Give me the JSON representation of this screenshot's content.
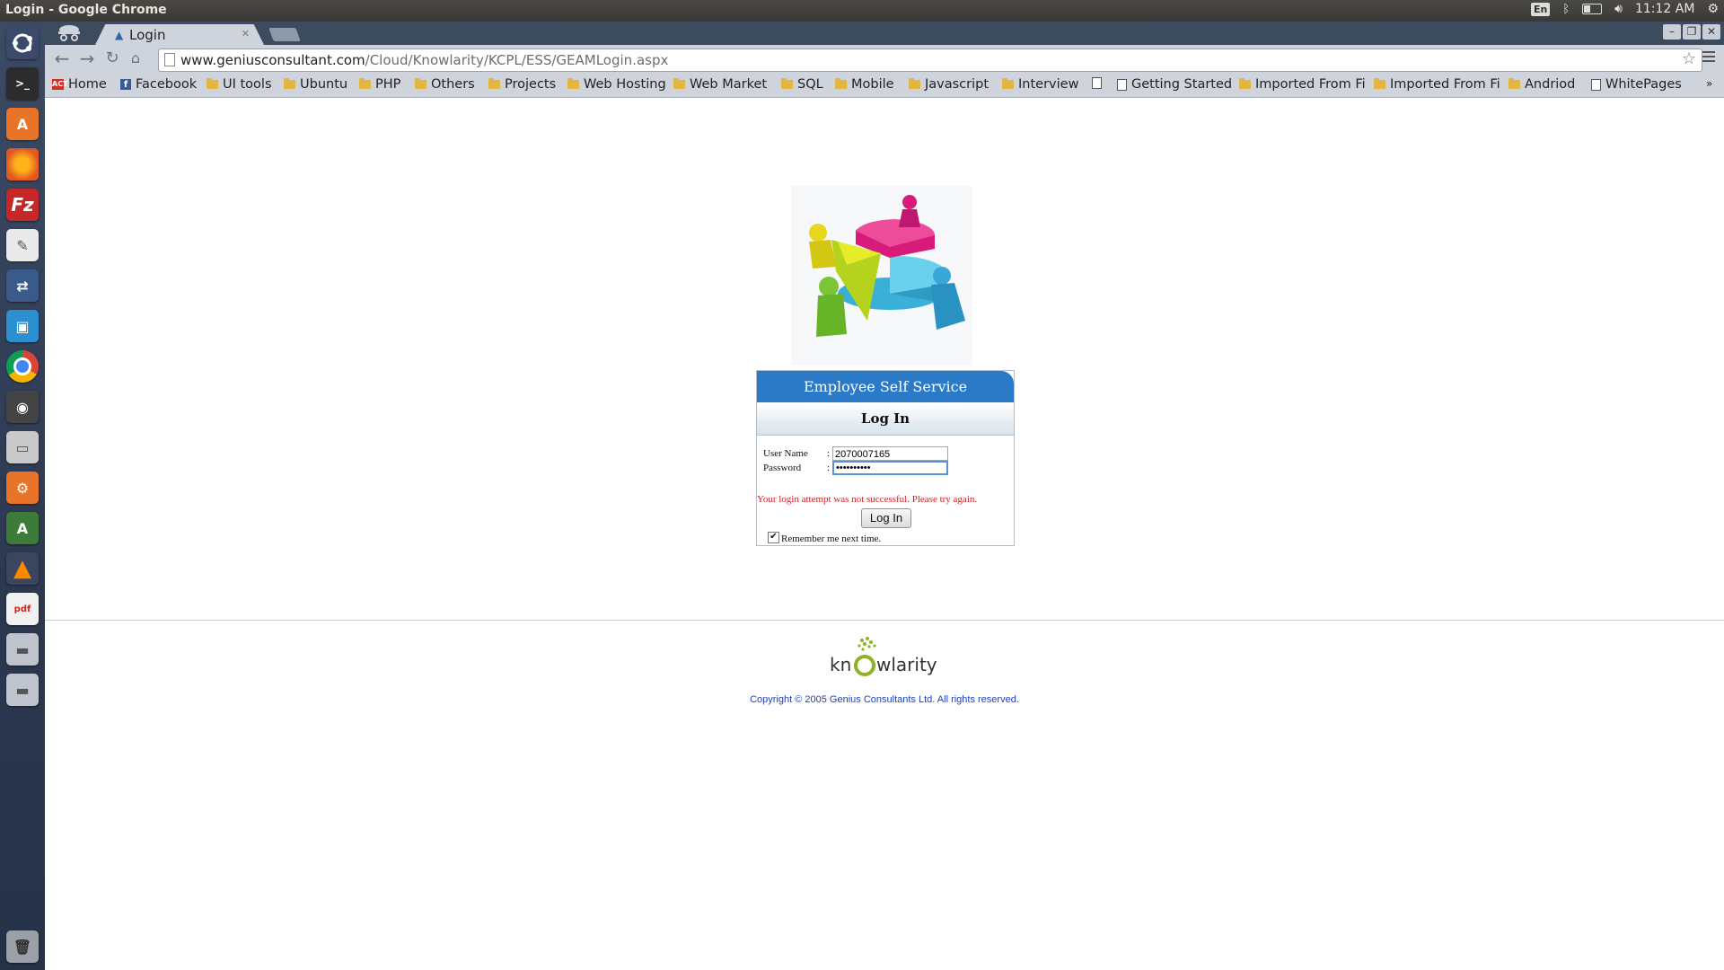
{
  "system_panel": {
    "window_title": "Login - Google Chrome",
    "keyboard_layout": "En",
    "clock": "11:12 AM"
  },
  "launcher": {
    "icons": [
      "ubuntu-dash-icon",
      "terminal-icon",
      "software-center-icon",
      "firefox-icon",
      "filezilla-icon",
      "text-editor-icon",
      "remote-desktop-icon",
      "app-icon",
      "chrome-icon",
      "camera-icon",
      "files-icon",
      "settings-icon",
      "android-studio-icon",
      "vlc-icon",
      "document-viewer-icon",
      "drive-icon",
      "drive-icon",
      "trash-icon"
    ]
  },
  "browser": {
    "tab_title": "Login",
    "url_host": "www.geniusconsultant.com",
    "url_path": "/Cloud/Knowlarity/KCPL/ESS/GEAMLogin.aspx",
    "bookmarks": [
      {
        "label": "Home",
        "icon": "home-favicon"
      },
      {
        "label": "Facebook",
        "icon": "facebook-favicon"
      },
      {
        "label": "UI tools",
        "icon": "folder-icon"
      },
      {
        "label": "Ubuntu",
        "icon": "folder-icon"
      },
      {
        "label": "PHP",
        "icon": "folder-icon"
      },
      {
        "label": "Others",
        "icon": "folder-icon"
      },
      {
        "label": "Projects",
        "icon": "folder-icon"
      },
      {
        "label": "Web Hosting",
        "icon": "folder-icon"
      },
      {
        "label": "Web Market",
        "icon": "folder-icon"
      },
      {
        "label": "SQL",
        "icon": "folder-icon"
      },
      {
        "label": "Mobile",
        "icon": "folder-icon"
      },
      {
        "label": "Javascript",
        "icon": "folder-icon"
      },
      {
        "label": "Interview",
        "icon": "folder-icon"
      },
      {
        "label": "",
        "icon": "page-icon"
      },
      {
        "label": "Getting Started",
        "icon": "page-icon"
      },
      {
        "label": "Imported From Fi",
        "icon": "folder-icon"
      },
      {
        "label": "Imported From Fi",
        "icon": "folder-icon"
      },
      {
        "label": "Andriod",
        "icon": "folder-icon"
      },
      {
        "label": "WhitePages",
        "icon": "page-icon"
      }
    ]
  },
  "login": {
    "header": "Employee Self Service",
    "title": "Log In",
    "username_label": "User Name",
    "username_value": "2070007165",
    "password_label": "Password",
    "password_value": "••••••••••",
    "separator": ":",
    "error": "Your login attempt was not successful. Please try again.",
    "button": "Log In",
    "remember_label": "Remember me next time.",
    "remember_checked": true
  },
  "footer": {
    "logo_text": "knowlarity",
    "copyright": "Copyright © 2005 Genius Consultants Ltd. All rights reserved."
  }
}
